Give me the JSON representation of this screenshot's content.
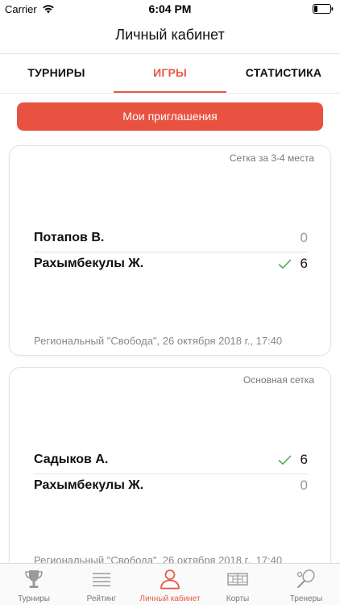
{
  "status_bar": {
    "carrier": "Carrier",
    "time": "6:04 PM"
  },
  "header": {
    "title": "Личный кабинет"
  },
  "tabs": [
    {
      "label": "ТУРНИРЫ",
      "active": false
    },
    {
      "label": "ИГРЫ",
      "active": true
    },
    {
      "label": "СТАТИСТИКА",
      "active": false
    }
  ],
  "invitations_button": {
    "label": "Мои приглашения"
  },
  "matches": [
    {
      "stage": "Сетка за 3-4 места",
      "players": [
        {
          "name": "Потапов В.",
          "score": "0",
          "winner": false
        },
        {
          "name": "Рахымбекулы Ж.",
          "score": "6",
          "winner": true
        }
      ],
      "footer": "Региональный \"Свобода\", 26 октября 2018 г., 17:40"
    },
    {
      "stage": "Основная сетка",
      "players": [
        {
          "name": "Садыков А.",
          "score": "6",
          "winner": true
        },
        {
          "name": "Рахымбекулы Ж.",
          "score": "0",
          "winner": false
        }
      ],
      "footer": "Региональный \"Свобода\", 26 октября 2018 г., 17:40"
    }
  ],
  "tab_bar": [
    {
      "label": "Турниры",
      "icon": "trophy-icon",
      "active": false
    },
    {
      "label": "Рейтинг",
      "icon": "list-icon",
      "active": false
    },
    {
      "label": "Личный кабинет",
      "icon": "profile-icon",
      "active": true
    },
    {
      "label": "Корты",
      "icon": "court-icon",
      "active": false
    },
    {
      "label": "Тренеры",
      "icon": "tennis-racket-icon",
      "active": false
    }
  ],
  "colors": {
    "accent": "#e85a45",
    "button": "#e95241",
    "winner_check": "#4caf50"
  }
}
